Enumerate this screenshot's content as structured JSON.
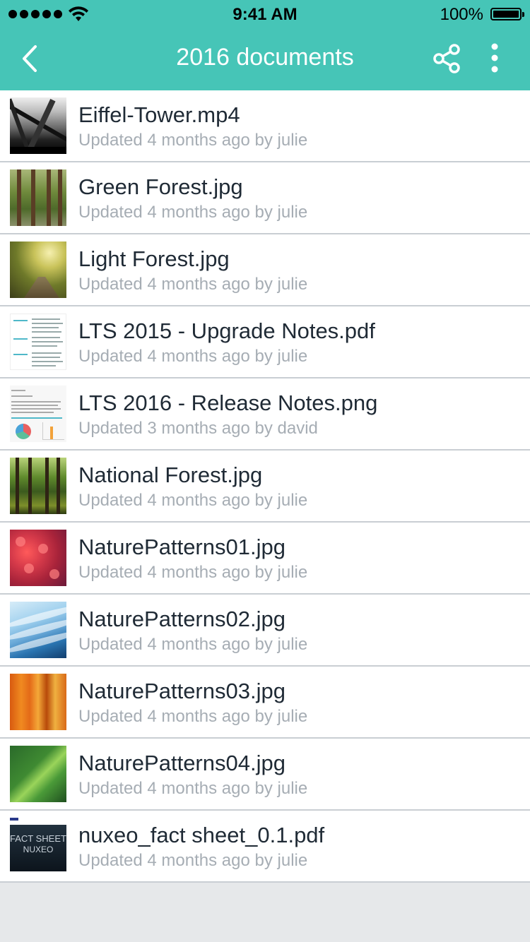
{
  "status_bar": {
    "time": "9:41 AM",
    "battery": "100%"
  },
  "header": {
    "title": "2016 documents",
    "back_icon": "chevron-left-icon",
    "share_icon": "share-icon",
    "more_icon": "more-vertical-icon",
    "background_color": "#46c5b7"
  },
  "documents": [
    {
      "name": "Eiffel-Tower.mp4",
      "meta": "Updated 4 months ago by julie",
      "thumb": "eiffel"
    },
    {
      "name": "Green Forest.jpg",
      "meta": "Updated 4 months ago by julie",
      "thumb": "green"
    },
    {
      "name": "Light Forest.jpg",
      "meta": "Updated 4 months ago by julie",
      "thumb": "light"
    },
    {
      "name": "LTS 2015 - Upgrade Notes.pdf",
      "meta": "Updated 4 months ago by julie",
      "thumb": "pdf"
    },
    {
      "name": "LTS 2016 - Release Notes.png",
      "meta": "Updated 3 months ago by david",
      "thumb": "png"
    },
    {
      "name": "National Forest.jpg",
      "meta": "Updated 4 months ago by julie",
      "thumb": "national"
    },
    {
      "name": "NaturePatterns01.jpg",
      "meta": "Updated 4 months ago by julie",
      "thumb": "np1"
    },
    {
      "name": "NaturePatterns02.jpg",
      "meta": "Updated 4 months ago by julie",
      "thumb": "np2"
    },
    {
      "name": "NaturePatterns03.jpg",
      "meta": "Updated 4 months ago by julie",
      "thumb": "np3"
    },
    {
      "name": "NaturePatterns04.jpg",
      "meta": "Updated 4 months ago by julie",
      "thumb": "np4"
    },
    {
      "name": "nuxeo_fact sheet_0.1.pdf",
      "meta": "Updated 4 months ago by julie",
      "thumb": "nuxeo"
    }
  ],
  "nuxeo_thumb_text": [
    "FACT SHEET",
    "NUXEO"
  ]
}
